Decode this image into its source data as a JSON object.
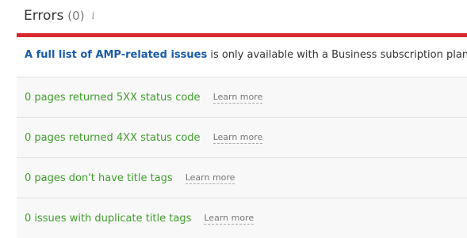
{
  "header": {
    "title": "Errors",
    "count": "(0)",
    "info_icon": "info-icon"
  },
  "colors": {
    "accent_bar": "#d7282f",
    "link": "#1a5ca8",
    "success_text": "#3f9e2b"
  },
  "notice": {
    "link_text": "A full list of AMP-related issues",
    "rest_text": " is only available with a Business subscription plan"
  },
  "rows": [
    {
      "label": "0 pages returned 5XX status code",
      "learn_more": "Learn more"
    },
    {
      "label": "0 pages returned 4XX status code",
      "learn_more": "Learn more"
    },
    {
      "label": "0 pages don't have title tags",
      "learn_more": "Learn more"
    },
    {
      "label": "0 issues with duplicate title tags",
      "learn_more": "Learn more"
    }
  ]
}
